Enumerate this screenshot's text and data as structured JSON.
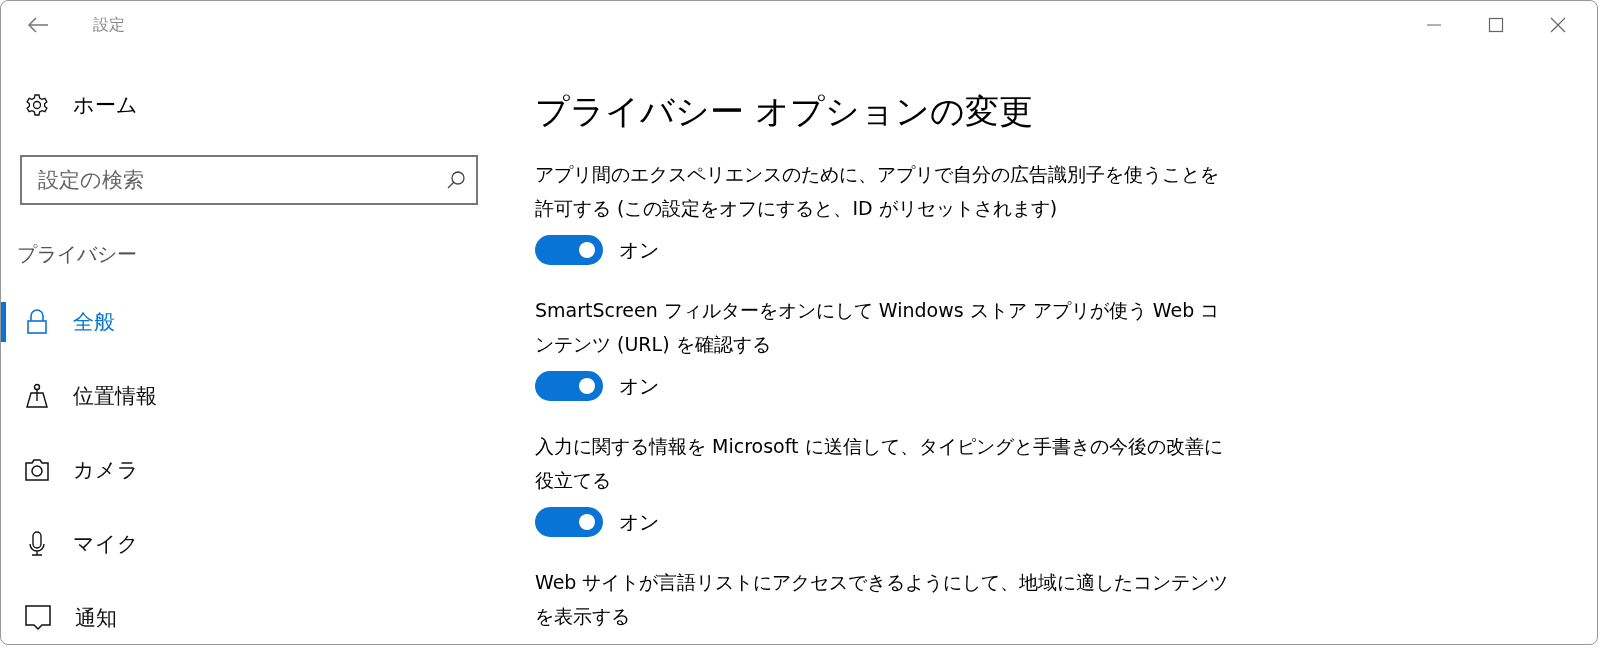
{
  "window": {
    "title": "設定"
  },
  "sidebar": {
    "home": "ホーム",
    "search": {
      "placeholder": "設定の検索"
    },
    "section": "プライバシー",
    "items": [
      {
        "label": "全般",
        "kind": "lock",
        "selected": true
      },
      {
        "label": "位置情報",
        "kind": "location",
        "selected": false
      },
      {
        "label": "カメラ",
        "kind": "camera",
        "selected": false
      },
      {
        "label": "マイク",
        "kind": "mic",
        "selected": false
      },
      {
        "label": "通知",
        "kind": "notify",
        "selected": false
      }
    ]
  },
  "content": {
    "title": "プライバシー オプションの変更",
    "settings": [
      {
        "description": "アプリ間のエクスペリエンスのために、アプリで自分の広告識別子を使うことを許可する (この設定をオフにすると、ID がリセットされます)",
        "on": true,
        "state": "オン"
      },
      {
        "description": "SmartScreen フィルターをオンにして Windows ストア アプリが使う Web コンテンツ (URL) を確認する",
        "on": true,
        "state": "オン"
      },
      {
        "description": "入力に関する情報を Microsoft に送信して、タイピングと手書きの今後の改善に役立てる",
        "on": true,
        "state": "オン"
      },
      {
        "description": "Web サイトが言語リストにアクセスできるようにして、地域に適したコンテンツを表示する"
      }
    ]
  }
}
